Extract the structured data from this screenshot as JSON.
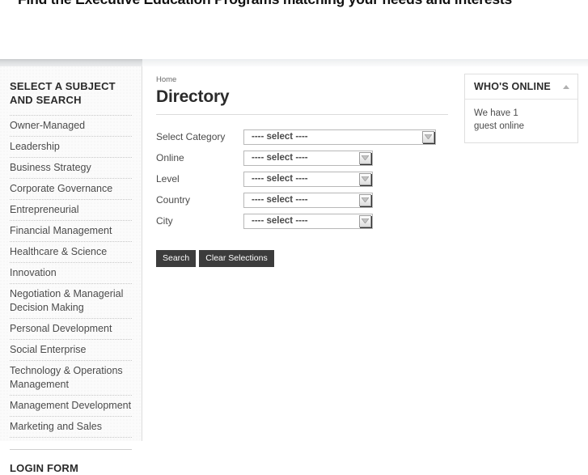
{
  "header": {
    "headline": "Find the Executive Education Programs matching your needs and interests"
  },
  "sidebar": {
    "heading": "SELECT A SUBJECT AND SEARCH",
    "items": [
      {
        "label": "Owner-Managed"
      },
      {
        "label": "Leadership"
      },
      {
        "label": "Business Strategy"
      },
      {
        "label": "Corporate Governance"
      },
      {
        "label": "Entrepreneurial"
      },
      {
        "label": "Financial Management"
      },
      {
        "label": "Healthcare & Science"
      },
      {
        "label": "Innovation"
      },
      {
        "label": "Negotiation & Managerial Decision Making"
      },
      {
        "label": "Personal Development"
      },
      {
        "label": "Social Enterprise"
      },
      {
        "label": "Technology & Operations Management"
      },
      {
        "label": "Management Development"
      },
      {
        "label": "Marketing and Sales"
      }
    ],
    "login_heading": "LOGIN FORM"
  },
  "main": {
    "breadcrumb": "Home",
    "title": "Directory",
    "form": {
      "rows": [
        {
          "label": "Select Category",
          "value": "---- select ----",
          "width": "wide"
        },
        {
          "label": "Online",
          "value": "---- select ----",
          "width": "narrow"
        },
        {
          "label": "Level",
          "value": "---- select ----",
          "width": "narrow"
        },
        {
          "label": "Country",
          "value": "---- select ----",
          "width": "narrow"
        },
        {
          "label": "City",
          "value": "---- select ----",
          "width": "narrow"
        }
      ]
    },
    "buttons": {
      "search": "Search",
      "clear": "Clear Selections"
    }
  },
  "rightcol": {
    "module": {
      "title": "WHO'S ONLINE",
      "collapse_icon": "caret-up-icon",
      "body_line1": "We have 1",
      "body_line2": "guest online"
    }
  },
  "colors": {
    "button_bg": "#3c3c3c",
    "text": "#4b4b4b",
    "heading": "#2a2a2a",
    "border": "#dedede"
  }
}
